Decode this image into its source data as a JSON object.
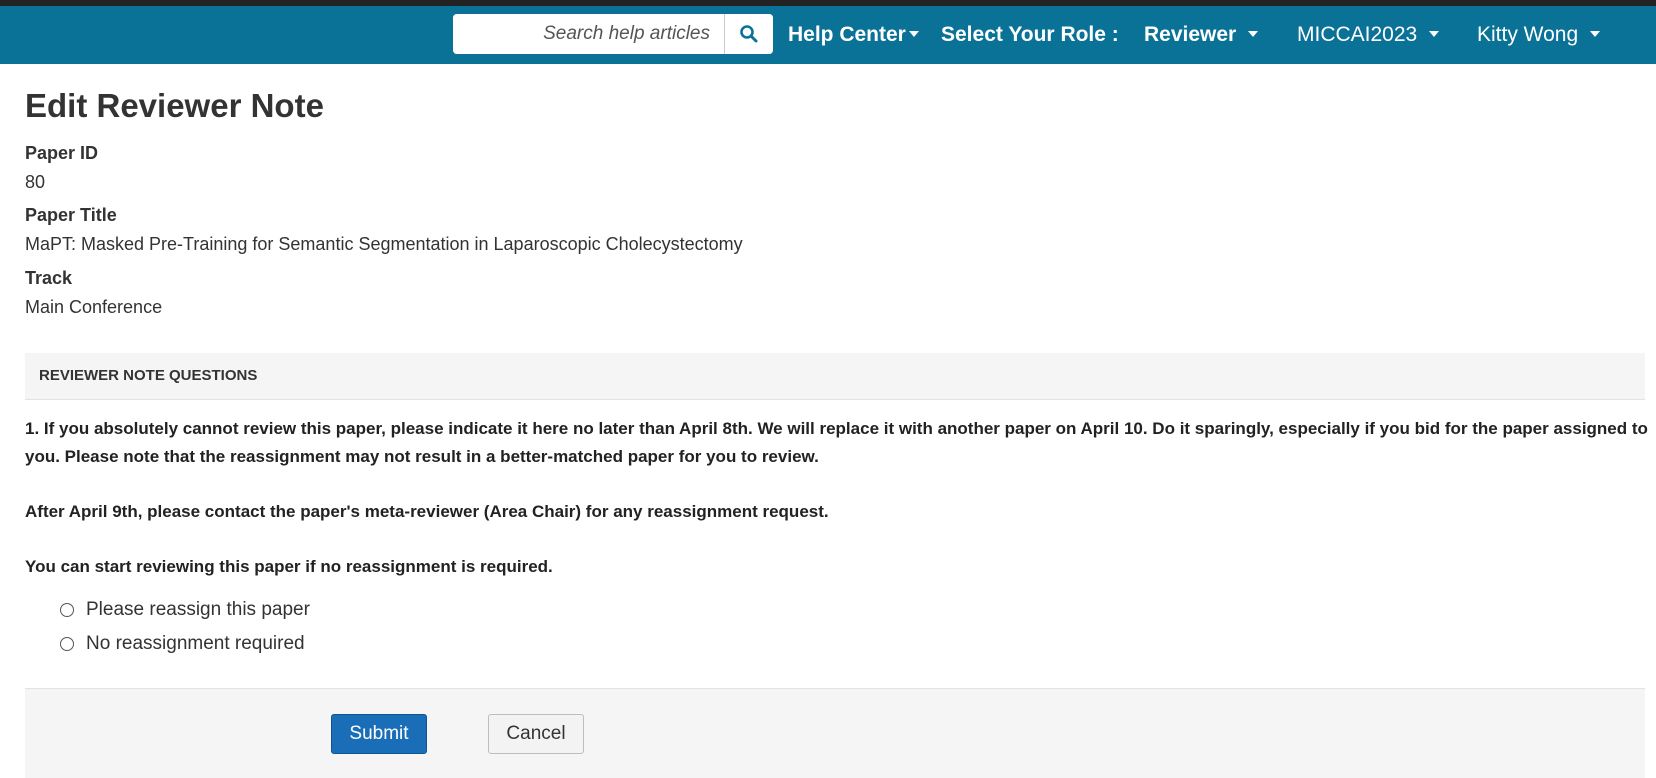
{
  "navbar": {
    "search_placeholder": "Search help articles",
    "help_center": "Help Center",
    "select_role_label": "Select Your Role :",
    "role": "Reviewer",
    "conference": "MICCAI2023",
    "user": "Kitty Wong"
  },
  "page": {
    "title": "Edit Reviewer Note"
  },
  "details": {
    "paper_id_label": "Paper ID",
    "paper_id": "80",
    "paper_title_label": "Paper Title",
    "paper_title": "MaPT: Masked Pre-Training for Semantic Segmentation in Laparoscopic Cholecystectomy",
    "track_label": "Track",
    "track": "Main Conference"
  },
  "section": {
    "header": "REVIEWER NOTE QUESTIONS"
  },
  "question": {
    "para1": "1. If you absolutely cannot review this paper, please indicate it here no later than April 8th. We will replace it with another paper on April 10. Do it sparingly, especially if you bid for the paper assigned to you. Please note that the reassignment may not result in a better-matched paper for you to review.",
    "para2": "After April 9th, please contact the paper's meta-reviewer (Area Chair) for any reassignment request.",
    "para3": "You can start reviewing this paper if no reassignment is required.",
    "options": [
      "Please reassign this paper",
      "No reassignment required"
    ],
    "selected": null
  },
  "actions": {
    "submit": "Submit",
    "cancel": "Cancel"
  },
  "colors": {
    "navbar": "#0b7297",
    "primary_button": "#1a6eb8"
  }
}
